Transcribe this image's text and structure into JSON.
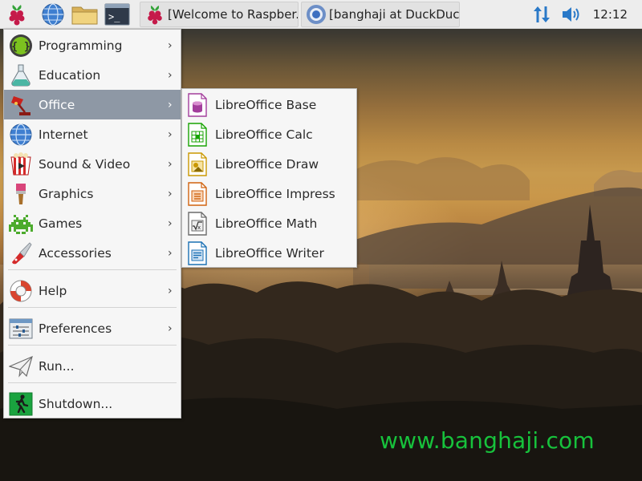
{
  "taskbar": {
    "launchers": [
      {
        "icon": "raspberry-icon"
      },
      {
        "icon": "web-browser-icon"
      },
      {
        "icon": "folder-icon"
      },
      {
        "icon": "terminal-icon"
      }
    ],
    "tasks": [
      {
        "label": "[Welcome to Raspber...",
        "icon": "raspberry-icon"
      },
      {
        "label": "[banghaji at DuckDuc...",
        "icon": "chromium-icon"
      }
    ],
    "tray": {
      "network_icon": "network-updown-icon",
      "volume_icon": "speaker-icon"
    },
    "clock": "12:12"
  },
  "main_menu": {
    "items": [
      {
        "label": "Programming",
        "icon": "programming-icon",
        "submenu": true
      },
      {
        "label": "Education",
        "icon": "education-flask-icon",
        "submenu": true
      },
      {
        "label": "Office",
        "icon": "office-lamp-icon",
        "submenu": true,
        "active": true
      },
      {
        "label": "Internet",
        "icon": "internet-globe-icon",
        "submenu": true
      },
      {
        "label": "Sound & Video",
        "icon": "sound-video-icon",
        "submenu": true
      },
      {
        "label": "Graphics",
        "icon": "graphics-brush-icon",
        "submenu": true
      },
      {
        "label": "Games",
        "icon": "games-invader-icon",
        "submenu": true
      },
      {
        "label": "Accessories",
        "icon": "accessories-knife-icon",
        "submenu": true
      },
      {
        "label": "Help",
        "icon": "help-lifebuoy-icon",
        "submenu": true
      },
      {
        "label": "Preferences",
        "icon": "preferences-icon",
        "submenu": true
      },
      {
        "label": "Run...",
        "icon": "run-paperplane-icon",
        "submenu": false
      },
      {
        "label": "Shutdown...",
        "icon": "shutdown-exit-icon",
        "submenu": false
      }
    ],
    "arrow_glyph": "›"
  },
  "office_submenu": {
    "items": [
      {
        "label": "LibreOffice Base",
        "icon": "libreoffice-base-icon",
        "color": "#a33e9c"
      },
      {
        "label": "LibreOffice Calc",
        "icon": "libreoffice-calc-icon",
        "color": "#18a303"
      },
      {
        "label": "LibreOffice Draw",
        "icon": "libreoffice-draw-icon",
        "color": "#ca9800"
      },
      {
        "label": "LibreOffice Impress",
        "icon": "libreoffice-impress-icon",
        "color": "#d0620e"
      },
      {
        "label": "LibreOffice Math",
        "icon": "libreoffice-math-icon",
        "color": "#6b6b6b"
      },
      {
        "label": "LibreOffice Writer",
        "icon": "libreoffice-writer-icon",
        "color": "#1a70b4"
      }
    ]
  },
  "watermark": "www.banghaji.com",
  "colors": {
    "menu_highlight": "#8e98a5",
    "watermark": "#17c23c",
    "taskbar": "#ededed"
  }
}
